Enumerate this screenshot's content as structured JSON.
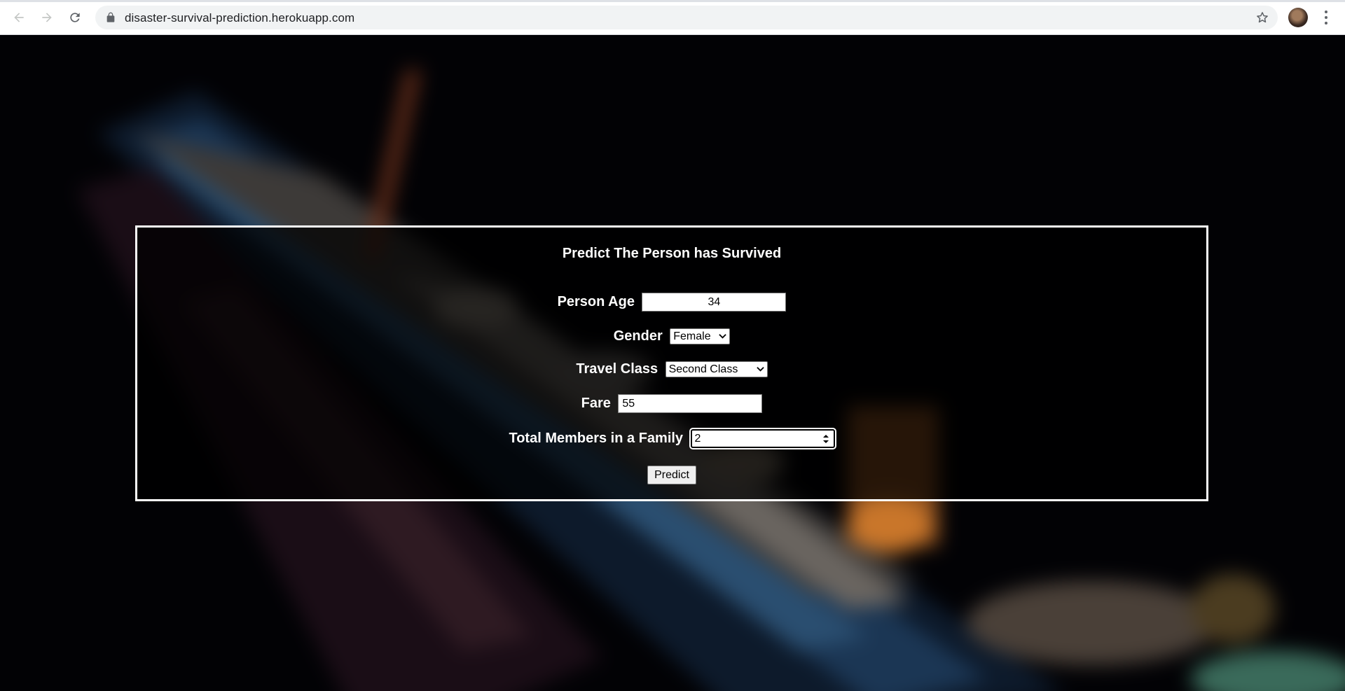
{
  "browser": {
    "url": "disaster-survival-prediction.herokuapp.com",
    "icons": {
      "back": "back-arrow-icon",
      "forward": "forward-arrow-icon",
      "reload": "reload-icon",
      "lock": "lock-icon",
      "bookmark": "star-icon",
      "menu": "kebab-menu-icon"
    }
  },
  "form": {
    "title": "Predict The Person has Survived",
    "age": {
      "label": "Person Age",
      "value": "34"
    },
    "gender": {
      "label": "Gender",
      "selected": "Female"
    },
    "travel_class": {
      "label": "Travel Class",
      "selected": "Second Class"
    },
    "fare": {
      "label": "Fare",
      "value": "55"
    },
    "family": {
      "label": "Total Members in a Family",
      "value": "2"
    },
    "submit_label": "Predict"
  },
  "colors": {
    "panel_border": "#ffffff",
    "page_background": "#000000",
    "label_text": "#ffffff"
  }
}
